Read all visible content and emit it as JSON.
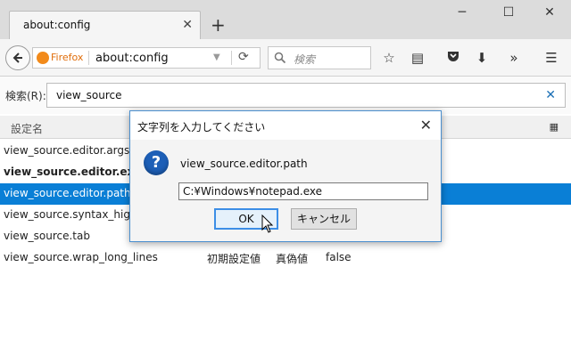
{
  "tab": {
    "title": "about:config"
  },
  "window_controls": {
    "minimize": "─",
    "maximize": "☐",
    "close": "✕"
  },
  "navbar": {
    "identity_label": "Firefox",
    "url": "about:config",
    "search_placeholder": "検索"
  },
  "filter": {
    "label": "検索(R):",
    "value": "view_source"
  },
  "columns": {
    "name": "設定名"
  },
  "rows": [
    {
      "name": "view_source.editor.args",
      "status": "",
      "type": "",
      "value": "",
      "bold": false,
      "selected": false
    },
    {
      "name": "view_source.editor.external",
      "status": "",
      "type": "",
      "value": "",
      "bold": true,
      "selected": false
    },
    {
      "name": "view_source.editor.path",
      "status": "",
      "type": "",
      "value": "",
      "bold": false,
      "selected": true
    },
    {
      "name": "view_source.syntax_highlig",
      "status": "",
      "type": "",
      "value": "",
      "bold": false,
      "selected": false
    },
    {
      "name": "view_source.tab",
      "status": "",
      "type": "",
      "value": "",
      "bold": false,
      "selected": false
    },
    {
      "name": "view_source.wrap_long_lines",
      "status": "初期設定値",
      "type": "真偽値",
      "value": "false",
      "bold": false,
      "selected": false
    }
  ],
  "dialog": {
    "title": "文字列を入力してください",
    "message": "view_source.editor.path",
    "input_value": "C:¥Windows¥notepad.exe",
    "ok_label": "OK",
    "cancel_label": "キャンセル"
  },
  "colors": {
    "selection": "#0a7fd6",
    "identity": "#e06d0a",
    "dialog_border": "#4a8fcf"
  }
}
